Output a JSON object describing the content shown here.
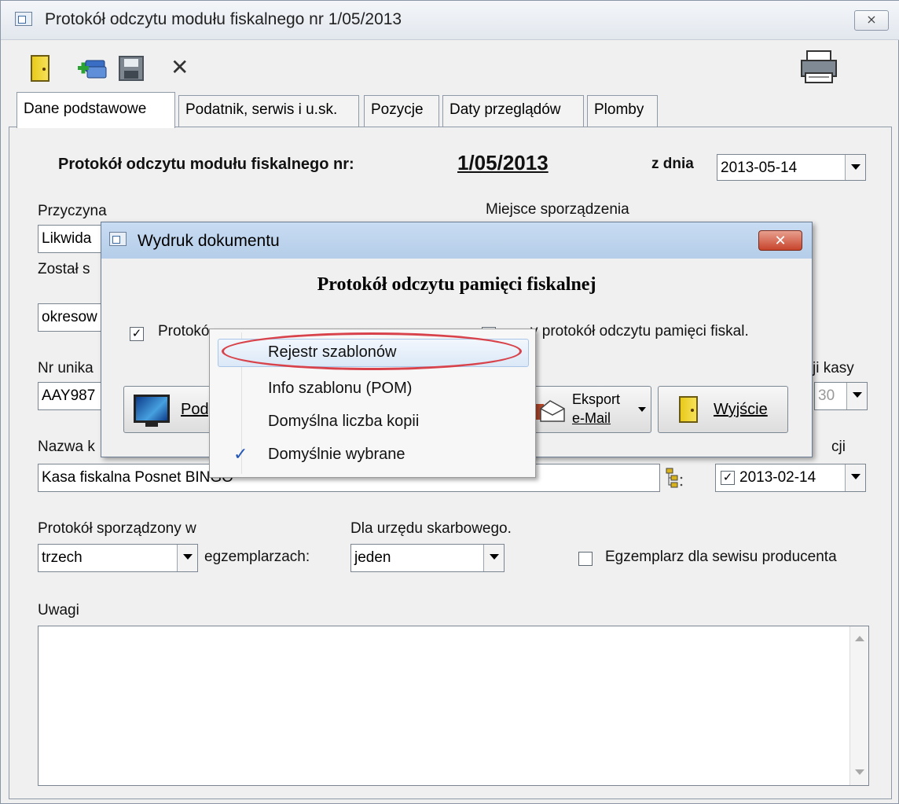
{
  "window": {
    "title": "Protokół odczytu modułu fiskalnego nr 1/05/2013",
    "close_label": "⨯"
  },
  "tabs": [
    {
      "label": "Dane podstawowe"
    },
    {
      "label": "Podatnik, serwis i u.sk."
    },
    {
      "label": "Pozycje"
    },
    {
      "label": "Daty przeglądów"
    },
    {
      "label": "Plomby"
    }
  ],
  "form": {
    "heading": "Protokół odczytu modułu fiskalnego nr:",
    "doc_number": "1/05/2013",
    "date_label": "z dnia",
    "date_value": "2013-05-14",
    "reason_label": "Przyczyna",
    "reason_value": "Likwida",
    "place_label": "Miejsce sporządzenia",
    "zostal_label": "Został s",
    "zostal_value": "okresow",
    "nr_unik_label": "Nr unika",
    "nr_unik_value": "AAY987",
    "kasy_label": "ji kasy",
    "kasy_value": "30",
    "nazwa_label": "Nazwa k",
    "cji_label": "cji",
    "device_name": "Kasa fiskalna Posnet BINGO",
    "device_date": "2013-02-14",
    "copies_label": "Protokół sporządzony w",
    "copies_value": "trzech",
    "copies_suffix": "egzemplarzach:",
    "tax_office_label": "Dla urzędu skarbowego.",
    "tax_office_value": "jeden",
    "service_copy_label": "Egzemplarz dla sewisu producenta",
    "notes_label": "Uwagi"
  },
  "dialog": {
    "title": "Wydruk dokumentu",
    "heading": "Protokół odczytu pamięci fiskalnej",
    "option1_label": "Protokó",
    "option2_label": "y protokół odczytu pamięci fiskal.",
    "preview_label": "Podg",
    "export_label_1": "Eksport",
    "export_label_2": "e-Mail",
    "exit_label": "Wyjście"
  },
  "context_menu": {
    "items": [
      {
        "label": "Rejestr szablonów",
        "highlighted": true
      },
      {
        "label": "Info szablonu (POM)"
      },
      {
        "label": "Domyślna liczba kopii"
      },
      {
        "label": "Domyślnie wybrane",
        "checked": true
      }
    ],
    "check_glyph": "✓"
  },
  "colors": {
    "highlight_oval": "#d8434b",
    "door_icon": "#e8c91a"
  }
}
